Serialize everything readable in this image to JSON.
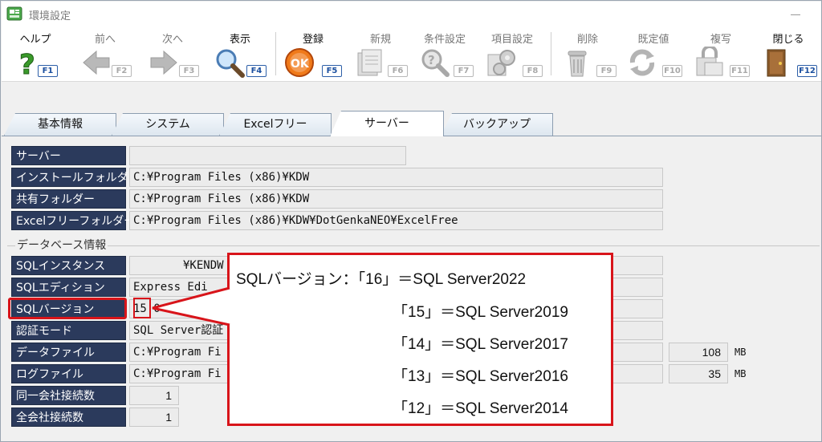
{
  "window": {
    "title": "環境設定"
  },
  "toolbar": {
    "buttons": [
      {
        "label": "ヘルプ",
        "key": "F1",
        "icon": "help-icon",
        "enabled": true
      },
      {
        "label": "前へ",
        "key": "F2",
        "icon": "arrow-left-icon",
        "enabled": false
      },
      {
        "label": "次へ",
        "key": "F3",
        "icon": "arrow-right-icon",
        "enabled": false
      },
      {
        "label": "表示",
        "key": "F4",
        "icon": "magnifier-icon",
        "enabled": true
      },
      {
        "label": "登録",
        "key": "F5",
        "icon": "ok-icon",
        "enabled": true
      },
      {
        "label": "新規",
        "key": "F6",
        "icon": "new-document-icon",
        "enabled": false
      },
      {
        "label": "条件設定",
        "key": "F7",
        "icon": "search-condition-icon",
        "enabled": false
      },
      {
        "label": "項目設定",
        "key": "F8",
        "icon": "item-settings-icon",
        "enabled": false
      },
      {
        "label": "削除",
        "key": "F9",
        "icon": "trash-icon",
        "enabled": false
      },
      {
        "label": "既定値",
        "key": "F10",
        "icon": "refresh-icon",
        "enabled": false
      },
      {
        "label": "複写",
        "key": "F11",
        "icon": "copy-icon",
        "enabled": false
      },
      {
        "label": "閉じる",
        "key": "F12",
        "icon": "exit-door-icon",
        "enabled": true
      }
    ]
  },
  "tabs": [
    {
      "label": "基本情報",
      "active": false
    },
    {
      "label": "システム",
      "active": false
    },
    {
      "label": "Excelフリー",
      "active": false
    },
    {
      "label": "サーバー",
      "active": true
    },
    {
      "label": "バックアップ",
      "active": false
    }
  ],
  "server": {
    "server_label": "サーバー",
    "server_value": "",
    "install_folder_label": "インストールフォルダー",
    "install_folder_value": "C:¥Program Files (x86)¥KDW",
    "shared_folder_label": "共有フォルダー",
    "shared_folder_value": "C:¥Program Files (x86)¥KDW",
    "excel_free_folder_label": "Excelフリーフォルダー",
    "excel_free_folder_value": "C:¥Program Files (x86)¥KDW¥DotGenkaNEO¥ExcelFree"
  },
  "database": {
    "group_title": "データベース情報",
    "sql_instance_label": "SQLインスタンス",
    "sql_instance_value": "¥KENDW",
    "sql_edition_label": "SQLエディション",
    "sql_edition_value": "Express Edi",
    "sql_version_label": "SQLバージョン",
    "sql_version_value": "15.0",
    "auth_mode_label": "認証モード",
    "auth_mode_value": "SQL Server認証",
    "data_file_label": "データファイル",
    "data_file_value": "C:¥Program Fi",
    "data_file_size": "108",
    "log_file_label": "ログファイル",
    "log_file_value": "C:¥Program Fi",
    "log_file_size": "35",
    "size_unit": "MB",
    "same_company_conn_label": "同一会社接続数",
    "same_company_conn_value": "1",
    "all_company_conn_label": "全会社接続数",
    "all_company_conn_value": "1"
  },
  "callout": {
    "lines": [
      "SQLバージョン：「16」＝SQL Server2022",
      "「15」＝SQL Server2019",
      "「14」＝SQL Server2017",
      "「13」＝SQL Server2016",
      "「12」＝SQL Server2014"
    ]
  },
  "colors": {
    "label_bg": "#2b3a5c",
    "highlight": "#d8141a",
    "fkey_blue": "#1b4f9f"
  }
}
